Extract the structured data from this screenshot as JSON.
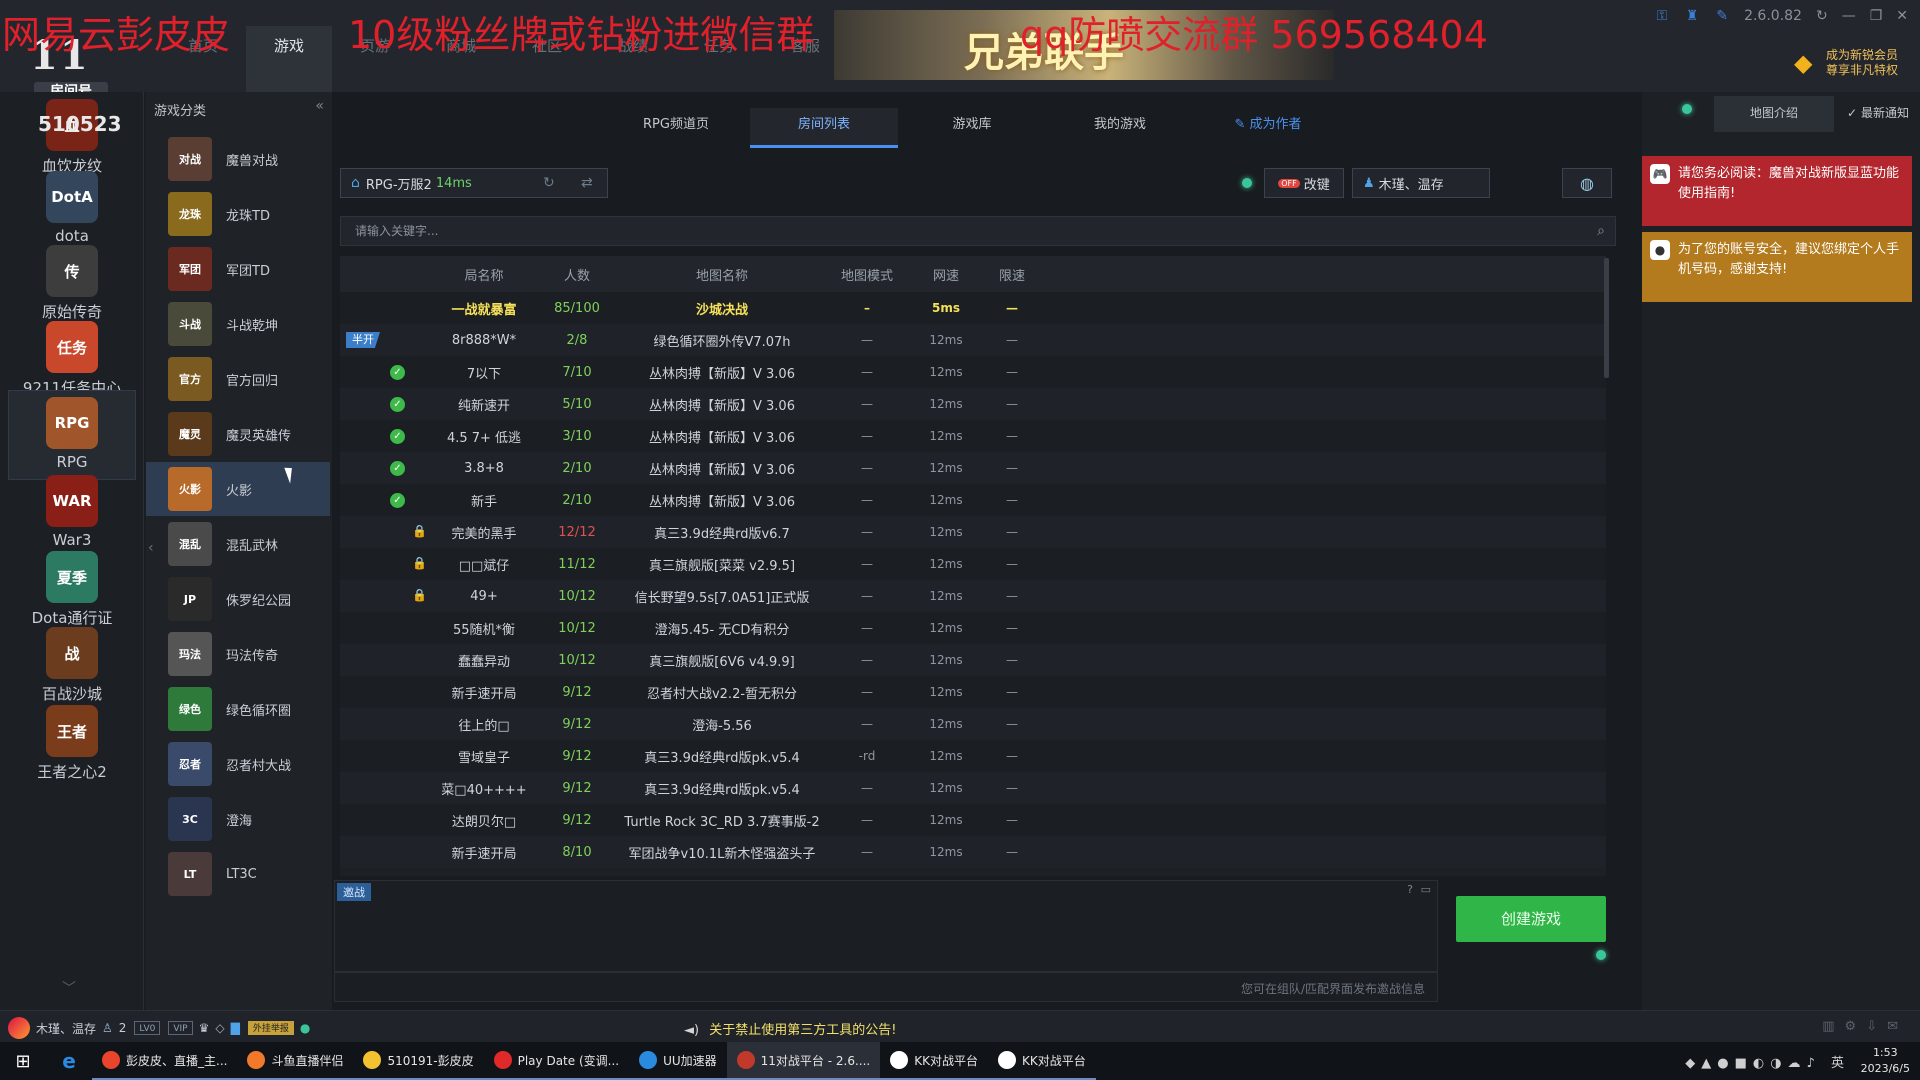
{
  "watermark": {
    "left": "网易云彭皮皮",
    "middle": "10级粉丝牌或钻粉进微信群",
    "right": "qq防喷交流群 569568404"
  },
  "logo": {
    "mark": "11",
    "sub": "房间号"
  },
  "room_number": "510523",
  "top_nav": [
    {
      "label": "首页",
      "active": false
    },
    {
      "label": "游戏",
      "active": true
    },
    {
      "label": "页游",
      "active": false
    },
    {
      "label": "商城",
      "active": false
    },
    {
      "label": "社区",
      "active": false
    },
    {
      "label": "战绩",
      "active": false
    },
    {
      "label": "任务",
      "active": false
    },
    {
      "label": "客服",
      "active": false
    }
  ],
  "banner": {
    "text": "兄弟联手"
  },
  "window": {
    "version": "2.6.0.82"
  },
  "vip": {
    "text": "成为新锐会员 尊享非凡特权"
  },
  "sidebar": {
    "items": [
      {
        "label": "血饮龙纹",
        "icon": "血",
        "color": "#7a2418"
      },
      {
        "label": "dota",
        "icon": "DotA",
        "color": "#33465c"
      },
      {
        "label": "原始传奇",
        "icon": "传",
        "color": "#3d3d3d"
      },
      {
        "label": "9211任务中心",
        "icon": "任务",
        "color": "#c9472a"
      },
      {
        "label": "RPG",
        "icon": "RPG",
        "color": "#a0562a"
      },
      {
        "label": "War3",
        "icon": "WAR",
        "color": "#8a1f18"
      },
      {
        "label": "Dota通行证",
        "icon": "夏季",
        "color": "#2c7a62"
      },
      {
        "label": "百战沙城",
        "icon": "战",
        "color": "#6b3d1e"
      },
      {
        "label": "王者之心2",
        "icon": "王者",
        "color": "#7a3c1a"
      }
    ]
  },
  "categories": {
    "title": "游戏分类",
    "items": [
      {
        "label": "魔兽对战",
        "icon": "对战",
        "color": "#5a3e33"
      },
      {
        "label": "龙珠TD",
        "icon": "龙珠",
        "color": "#8a6a1c"
      },
      {
        "label": "军团TD",
        "icon": "军团",
        "color": "#6a2a20"
      },
      {
        "label": "斗战乾坤",
        "icon": "斗战",
        "color": "#4a4a3a"
      },
      {
        "label": "官方回归",
        "icon": "官方",
        "color": "#7a5a20"
      },
      {
        "label": "魔灵英雄传",
        "icon": "魔灵",
        "color": "#5a3a1a"
      },
      {
        "label": "火影",
        "icon": "火影",
        "color": "#b86a2a"
      },
      {
        "label": "混乱武林",
        "icon": "混乱",
        "color": "#4a4a4a"
      },
      {
        "label": "侏罗纪公园",
        "icon": "JP",
        "color": "#2a2a2a"
      },
      {
        "label": "玛法传奇",
        "icon": "玛法",
        "color": "#555555"
      },
      {
        "label": "绿色循环圈",
        "icon": "绿色",
        "color": "#2e7a3a"
      },
      {
        "label": "忍者村大战",
        "icon": "忍者",
        "color": "#3a4a6a"
      },
      {
        "label": "澄海",
        "icon": "3C",
        "color": "#2a3550"
      },
      {
        "label": "LT3C",
        "icon": "LT",
        "color": "#4a3a3a"
      }
    ]
  },
  "tabs": [
    {
      "label": "RPG频道页",
      "active": false
    },
    {
      "label": "房间列表",
      "active": true
    },
    {
      "label": "游戏库",
      "active": false
    },
    {
      "label": "我的游戏",
      "active": false
    },
    {
      "label": "成为作者",
      "active": false
    }
  ],
  "server": {
    "name": "RPG-万服2",
    "ping": "14ms"
  },
  "gaijian_label": "改键",
  "gaijian_toggle": "OFF",
  "user_label": "木瑾、温存",
  "search": {
    "placeholder": "请输入关键字..."
  },
  "table": {
    "headers": [
      "局名称",
      "人数",
      "地图名称",
      "地图模式",
      "网速",
      "限速"
    ],
    "rows": [
      {
        "flag": "",
        "name": "一战就暴富",
        "count": "85/100",
        "map": "沙城决战",
        "mode": "–",
        "ping": "5ms",
        "limit": "—",
        "featured": true
      },
      {
        "flag": "half",
        "name": "8r888*W*",
        "count": "2/8",
        "map": "绿色循环圈外传V7.07h",
        "mode": "—",
        "ping": "12ms",
        "limit": "—"
      },
      {
        "flag": "check",
        "name": "7以下",
        "count": "7/10",
        "map": "丛林肉搏【新版】V 3.06",
        "mode": "—",
        "ping": "12ms",
        "limit": "—"
      },
      {
        "flag": "check",
        "name": "纯新速开",
        "count": "5/10",
        "map": "丛林肉搏【新版】V 3.06",
        "mode": "—",
        "ping": "12ms",
        "limit": "—"
      },
      {
        "flag": "check",
        "name": "4.5 7+ 低逃",
        "count": "3/10",
        "map": "丛林肉搏【新版】V 3.06",
        "mode": "—",
        "ping": "12ms",
        "limit": "—"
      },
      {
        "flag": "check",
        "name": "3.8+8",
        "count": "2/10",
        "map": "丛林肉搏【新版】V 3.06",
        "mode": "—",
        "ping": "12ms",
        "limit": "—"
      },
      {
        "flag": "check",
        "name": "新手",
        "count": "2/10",
        "map": "丛林肉搏【新版】V 3.06",
        "mode": "—",
        "ping": "12ms",
        "limit": "—"
      },
      {
        "flag": "lock",
        "name": "完美的黑手",
        "count": "12/12",
        "map": "真三3.9d经典rd版v6.7",
        "mode": "—",
        "ping": "12ms",
        "limit": "—",
        "full": true
      },
      {
        "flag": "lock",
        "name": "□□斌仔",
        "count": "11/12",
        "map": "真三旗舰版[菜菜 v2.9.5]",
        "mode": "—",
        "ping": "12ms",
        "limit": "—"
      },
      {
        "flag": "lock",
        "name": "49+",
        "count": "10/12",
        "map": "信长野望9.5s[7.0A51]正式版",
        "mode": "—",
        "ping": "12ms",
        "limit": "—"
      },
      {
        "flag": "",
        "name": "55随机*衡",
        "count": "10/12",
        "map": "澄海5.45- 无CD有积分",
        "mode": "—",
        "ping": "12ms",
        "limit": "—"
      },
      {
        "flag": "",
        "name": "蠢蠢异动",
        "count": "10/12",
        "map": "真三旗舰版[6V6 v4.9.9]",
        "mode": "—",
        "ping": "12ms",
        "limit": "—"
      },
      {
        "flag": "",
        "name": "新手速开局",
        "count": "9/12",
        "map": "忍者村大战v2.2-暂无积分",
        "mode": "—",
        "ping": "12ms",
        "limit": "—"
      },
      {
        "flag": "",
        "name": "往上的□",
        "count": "9/12",
        "map": "澄海-5.56",
        "mode": "—",
        "ping": "12ms",
        "limit": "—"
      },
      {
        "flag": "",
        "name": "雪域皇子",
        "count": "9/12",
        "map": "真三3.9d经典rd版pk.v5.4",
        "mode": "-rd",
        "ping": "12ms",
        "limit": "—"
      },
      {
        "flag": "",
        "name": "菜□40++++",
        "count": "9/12",
        "map": "真三3.9d经典rd版pk.v5.4",
        "mode": "—",
        "ping": "12ms",
        "limit": "—"
      },
      {
        "flag": "",
        "name": "达朗贝尔□",
        "count": "9/12",
        "map": "Turtle Rock 3C_RD 3.7赛事版-2",
        "mode": "—",
        "ping": "12ms",
        "limit": "—"
      },
      {
        "flag": "",
        "name": "新手速开局",
        "count": "8/10",
        "map": "军团战争v10.1L新木怪强盗头子",
        "mode": "—",
        "ping": "12ms",
        "limit": "—"
      }
    ]
  },
  "chat": {
    "tag": "邀战",
    "help": "?",
    "hint": "您可在组队/匹配界面发布邀战信息"
  },
  "create_button": "创建游戏",
  "right_panel": {
    "tab1": "地图介绍",
    "tab2": "最新通知",
    "notice1": "请您务必阅读：魔兽对战新版显蓝功能使用指南!",
    "notice2": "为了您的账号安全，建议您绑定个人手机号码，感谢支持!"
  },
  "status_bar": {
    "username": "木瑾、温存",
    "friends": "2",
    "badge_lv": "LV0",
    "badge_ext": "外挂举报",
    "announcement": "关于禁止使用第三方工具的公告!"
  },
  "taskbar": {
    "items": [
      {
        "label": "彭皮皮、直播_主...",
        "color": "#e8452c"
      },
      {
        "label": "斗鱼直播伴侣",
        "color": "#f07a2a"
      },
      {
        "label": "510191-彭皮皮",
        "color": "#f2c230"
      },
      {
        "label": "Play Date (变调...",
        "color": "#e02a2a"
      },
      {
        "label": "UU加速器",
        "color": "#2a8ae0"
      },
      {
        "label": "11对战平台 - 2.6....",
        "color": "#c0392b",
        "current": true
      },
      {
        "label": "KK对战平台",
        "color": "#ffffff"
      },
      {
        "label": "KK对战平台",
        "color": "#ffffff"
      }
    ],
    "ime": "英",
    "time": "1:53",
    "date": "2023/6/5"
  }
}
